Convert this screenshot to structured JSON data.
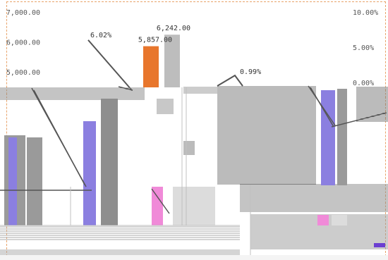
{
  "chart_data": {
    "type": "bar",
    "categories": [
      "",
      "",
      ""
    ],
    "series": [
      {
        "name": "",
        "kind": "bar",
        "axis": "left",
        "color": "#e8762c",
        "values": [
          5857.0
        ]
      },
      {
        "name": "",
        "kind": "bar",
        "axis": "left",
        "color": "#bdbdbd",
        "values": [
          6242.0
        ]
      },
      {
        "name": "",
        "kind": "line",
        "axis": "right",
        "color": "#555555",
        "values": [
          6.02,
          0.99
        ]
      }
    ],
    "left_axis": {
      "ticks": [
        "7,000.00",
        "6,000.00",
        "5,000.00"
      ],
      "ylim": [
        5000,
        7000
      ]
    },
    "right_axis": {
      "ticks": [
        "10.00%",
        "5.00%",
        "0.00%"
      ],
      "ylim": [
        0,
        10
      ]
    },
    "data_labels": [
      "5,857.00",
      "6,242.00",
      "6.02%",
      "0.99%"
    ],
    "grid": false,
    "legend": "bottom-left"
  },
  "colors": {
    "frame": "#e8a36a",
    "bar_primary": "#e8762c",
    "bar_secondary": "#bdbdbd",
    "accent_purple": "#8b7fe0",
    "accent_pink": "#f08ad8",
    "line": "#555555"
  }
}
